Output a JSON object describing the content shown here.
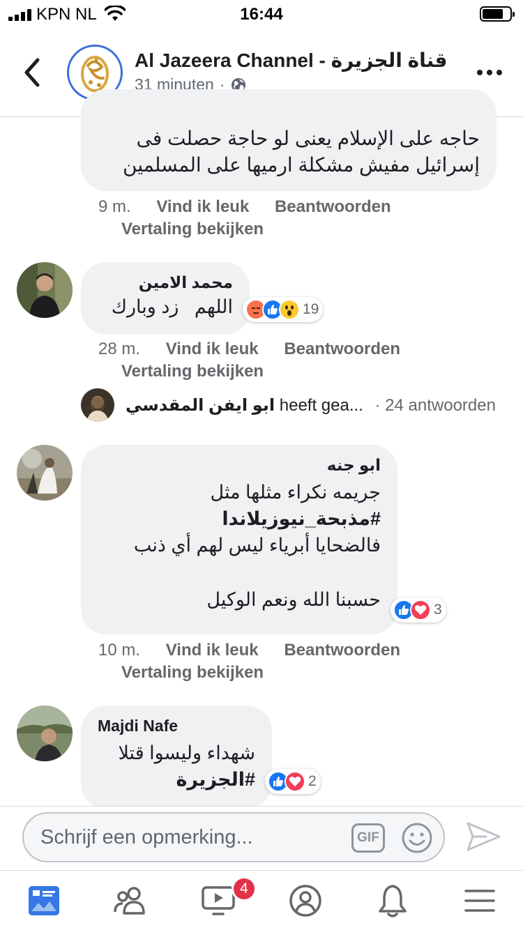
{
  "status_bar": {
    "carrier": "KPN NL",
    "time": "16:44",
    "battery_level": 0.75
  },
  "header": {
    "page_name": "Al Jazeera Channel - قناة الجزيرة",
    "post_time": "31 minuten",
    "privacy_separator": "·",
    "icons": {
      "back": "chevron-left-icon",
      "privacy": "globe-icon",
      "more": "more-dots-icon"
    }
  },
  "comments": [
    {
      "text_lines": [
        "حاجه على الإسلام يعنى لو حاجة حصلت فى",
        "إسرائيل مفيش مشكلة ارميها على المسلمين"
      ],
      "time": "9 m.",
      "like_label": "Vind ik leuk",
      "reply_label": "Beantwoorden",
      "translate_label": "Vertaling bekijken"
    },
    {
      "author": "محمد الامين",
      "text_lines": [
        "اللهم   زد وبارك"
      ],
      "reactions": [
        "angry",
        "like",
        "wow"
      ],
      "reaction_count": "19",
      "time": "28 m.",
      "like_label": "Vind ik leuk",
      "reply_label": "Beantwoorden",
      "translate_label": "Vertaling bekijken",
      "replies": {
        "replier": "ابو ايفن المقدسي",
        "preview": "heeft gea...",
        "count_text": "· 24 antwoorden"
      }
    },
    {
      "author": "ابو جنه",
      "text_lines": [
        "جريمه نكراء مثلها مثل",
        "#مذبحة_نيوزيلاندا",
        "فالضحايا أبرياء ليس لهم أي ذنب",
        "",
        "حسبنا الله ونعم الوكيل"
      ],
      "reactions": [
        "like",
        "love"
      ],
      "reaction_count": "3",
      "time": "10 m.",
      "like_label": "Vind ik leuk",
      "reply_label": "Beantwoorden",
      "translate_label": "Vertaling bekijken"
    },
    {
      "author": "Majdi Nafe",
      "text_lines": [
        "شهداء وليسوا قتلا",
        "#الجزيرة"
      ],
      "reactions": [
        "like",
        "love"
      ],
      "reaction_count": "2"
    }
  ],
  "composer": {
    "placeholder": "Schrijf een opmerking...",
    "gif_label": "GIF"
  },
  "tab_bar": {
    "tabs": [
      "news-feed-icon",
      "friends-icon",
      "watch-icon",
      "profile-icon",
      "notifications-icon",
      "menu-icon"
    ],
    "watch_badge": "4"
  },
  "colors": {
    "accent": "#4267b2",
    "bubble": "#eff1f3",
    "secondary_text": "#65676b",
    "like_blue": "#1877f2",
    "love_red": "#f33e58",
    "badge_red": "#e4314a"
  }
}
